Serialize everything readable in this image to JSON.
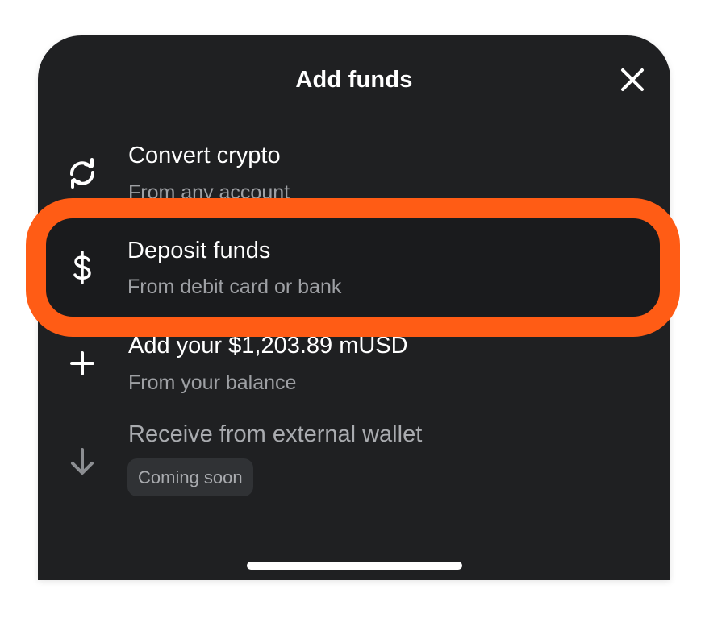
{
  "sheet": {
    "title": "Add funds",
    "close_icon": "close-icon"
  },
  "options": [
    {
      "icon": "convert-arrows-icon",
      "title": "Convert crypto",
      "subtitle": "From any account"
    },
    {
      "icon": "dollar-icon",
      "title": "Deposit funds",
      "subtitle": "From debit card or bank",
      "highlighted": true
    },
    {
      "icon": "plus-icon",
      "title": "Add your $1,203.89 mUSD",
      "subtitle": "From your balance"
    },
    {
      "icon": "arrow-down-icon",
      "title": "Receive from external wallet",
      "badge": "Coming soon",
      "disabled": true
    }
  ],
  "colors": {
    "sheet_background": "#1f2022",
    "highlight": "#ff5c15",
    "text_primary": "#ffffff",
    "text_secondary": "#9ea0a4"
  }
}
